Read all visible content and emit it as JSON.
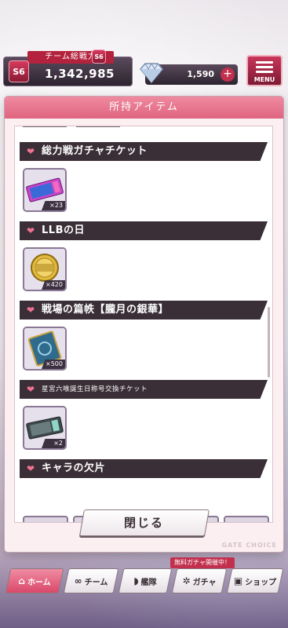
{
  "status": {
    "power_label": "チーム総戦力",
    "rank_left": "S6",
    "rank_right": "S6",
    "power_value": "1,342,985",
    "gem_value": "1,590",
    "plus": "+",
    "menu_label": "MENU"
  },
  "modal": {
    "title": "所持アイテム",
    "close_label": "閉じる",
    "watermark": "GATE CHOICE"
  },
  "sections": [
    {
      "title": "総力戦ガチャチケット",
      "count": "×23",
      "icon": "ticket-icon"
    },
    {
      "title": "LLBの日",
      "count": "×420",
      "icon": "coin-icon"
    },
    {
      "title": "戦場の篇帙【朧月の銀華】",
      "count": "×500",
      "icon": "book-icon"
    },
    {
      "title": "星宮六喰誕生日称号交換チケット",
      "count": "×2",
      "icon": "dark-ticket-icon"
    },
    {
      "title": "キャラの欠片",
      "count": "",
      "icon": "fragment-icon"
    }
  ],
  "nav": {
    "gacha_banner": "無料ガチャ開催中！",
    "items": [
      {
        "label": "ホーム",
        "icon": "home-icon"
      },
      {
        "label": "チーム",
        "icon": "team-icon"
      },
      {
        "label": "艦隊",
        "icon": "fleet-icon"
      },
      {
        "label": "ガチャ",
        "icon": "gacha-icon"
      },
      {
        "label": "ショップ",
        "icon": "shop-icon"
      }
    ]
  },
  "colors": {
    "accent": "#e0647f",
    "section_bg": "#3a2f36",
    "heart": "#ef7491"
  }
}
